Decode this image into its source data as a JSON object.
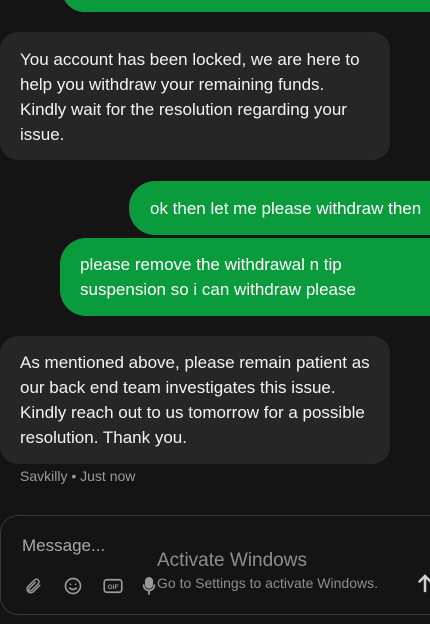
{
  "messages": [
    {
      "id": "m0",
      "direction": "outgoing",
      "text": ""
    },
    {
      "id": "m1",
      "direction": "incoming",
      "text": "You account has been locked, we are here to help you withdraw your remaining funds. Kindly wait for the resolution regarding your issue."
    },
    {
      "id": "m2",
      "direction": "outgoing",
      "text": "ok then let me please withdraw then"
    },
    {
      "id": "m3",
      "direction": "outgoing",
      "text": "please remove the withdrawal n tip suspension so i can withdraw please"
    },
    {
      "id": "m4",
      "direction": "incoming",
      "text": "As mentioned above, please remain patient as our back end team investigates this issue. Kindly reach out to us tomorrow for a possible resolution. Thank you."
    }
  ],
  "last_meta": {
    "sender": "Savkilly",
    "separator": "•",
    "time": "Just now",
    "full": "Savkilly • Just now"
  },
  "composer": {
    "placeholder": "Message...",
    "icons": [
      "paperclip-icon",
      "emoji-icon",
      "gif-icon",
      "microphone-icon",
      "send-arrow-icon"
    ],
    "gif_label": "GIF"
  },
  "watermark": {
    "title": "Activate Windows",
    "subtitle": "Go to Settings to activate Windows."
  },
  "colors": {
    "background": "#141414",
    "incoming_bubble": "#262626",
    "outgoing_bubble": "#0a9b3c",
    "text": "#f2f2f2",
    "muted": "#9a9a9a"
  }
}
